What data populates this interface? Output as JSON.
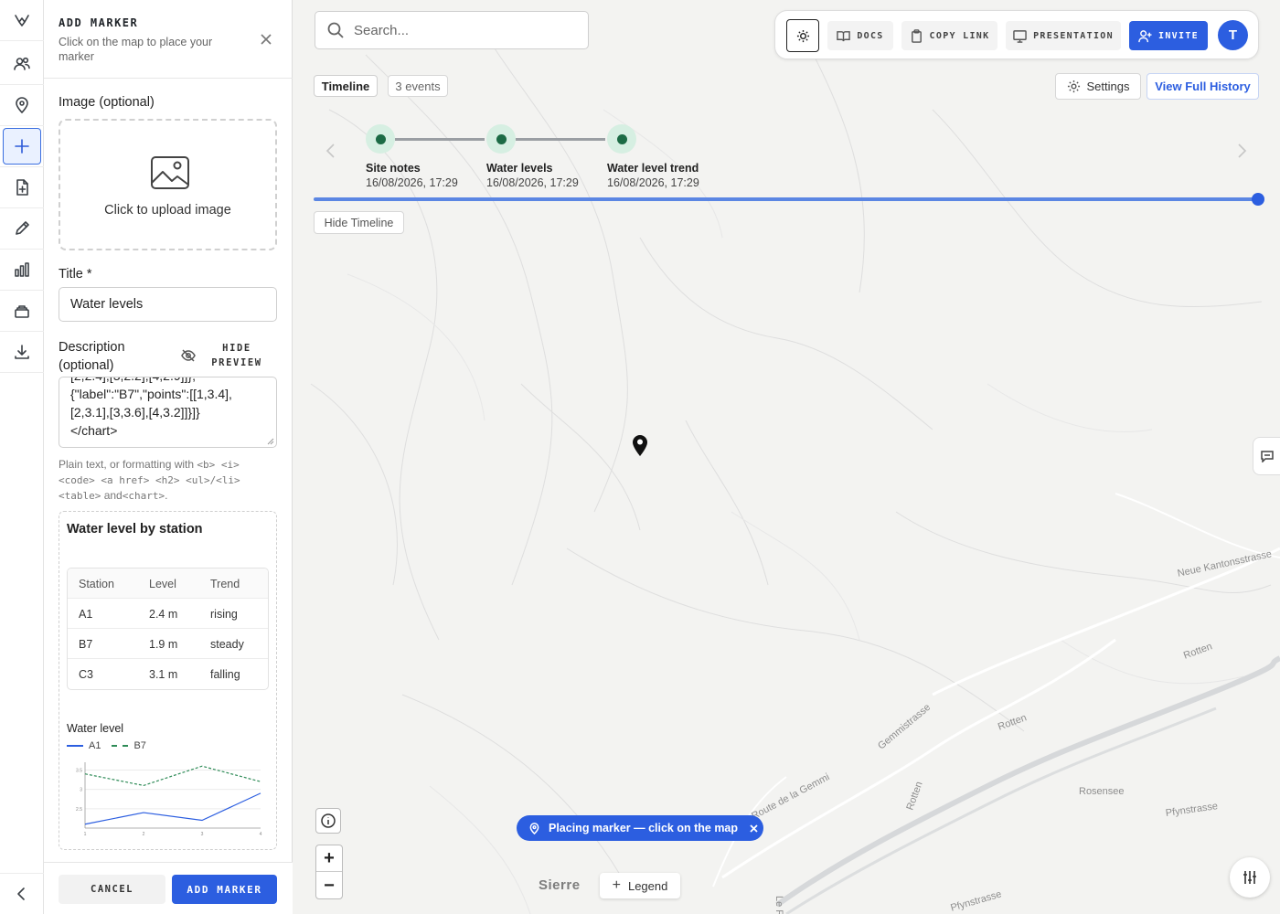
{
  "rail": {
    "items": [
      {
        "name": "logo-icon",
        "active": false
      },
      {
        "name": "users-icon",
        "active": false
      },
      {
        "name": "location-pin-icon",
        "active": false
      },
      {
        "name": "plus-icon",
        "active": true
      },
      {
        "name": "file-add-icon",
        "active": false
      },
      {
        "name": "pencil-icon",
        "active": false
      },
      {
        "name": "bar-chart-icon",
        "active": false
      },
      {
        "name": "layers-icon",
        "active": false
      },
      {
        "name": "download-icon",
        "active": false
      }
    ],
    "collapse_icon": "chevron-left-icon"
  },
  "panel": {
    "title": "ADD MARKER",
    "subtitle": "Click on the map to place your marker",
    "image_label": "Image (optional)",
    "upload_text": "Click to upload image",
    "title_label": "Title *",
    "title_value": "Water levels",
    "description_label": "Description (optional)",
    "hide_preview": "HIDE PREVIEW",
    "description_value": "[2,2.4],[3,2.2],[4,2.9]]},\n{\"label\":\"B7\",\"points\":[[1,3.4],\n[2,3.1],[3,3.6],[4,3.2]]}]}\n</chart>",
    "help": {
      "prefix": "Plain text, or formatting with",
      "tags1": "<b> <i> <code> <a href> <h2> <ul>/<li>",
      "tags2": "<table>",
      "and": "and",
      "tags3": "<chart>",
      "suffix": "."
    },
    "cancel": "CANCEL",
    "add": "ADD MARKER"
  },
  "preview": {
    "title": "Water level by station",
    "table": {
      "headers": [
        "Station",
        "Level",
        "Trend"
      ],
      "rows": [
        [
          "A1",
          "2.4 m",
          "rising"
        ],
        [
          "B7",
          "1.9 m",
          "steady"
        ],
        [
          "C3",
          "3.1 m",
          "falling"
        ]
      ]
    }
  },
  "chart_data": {
    "type": "line",
    "title": "Water level",
    "xlabel": "",
    "ylabel": "",
    "x": [
      1,
      2,
      3,
      4
    ],
    "series": [
      {
        "name": "A1",
        "values": [
          2.1,
          2.4,
          2.2,
          2.9
        ],
        "color": "#2c5ee0",
        "dash": "solid"
      },
      {
        "name": "B7",
        "values": [
          3.4,
          3.1,
          3.6,
          3.2
        ],
        "color": "#2e8b57",
        "dash": "dashed"
      }
    ],
    "ylim": [
      2.0,
      3.7
    ],
    "grid": true,
    "legend": "top-left"
  },
  "map": {
    "search_placeholder": "Search...",
    "toolbar": {
      "theme_icon": "sun-icon",
      "docs": "DOCS",
      "copy_link": "COPY LINK",
      "presentation": "PRESENTATION",
      "invite": "INVITE",
      "avatar_initial": "T"
    },
    "timeline_label": "Timeline",
    "events_count": "3 events",
    "settings": "Settings",
    "view_history": "View Full History",
    "hide_timeline": "Hide Timeline",
    "events": [
      {
        "name": "Site notes",
        "date": "16/08/2026, 17:29"
      },
      {
        "name": "Water levels",
        "date": "16/08/2026, 17:29"
      },
      {
        "name": "Water level trend",
        "date": "16/08/2026, 17:29"
      }
    ],
    "placing_banner": "Placing marker — click on the map",
    "legend": "Legend",
    "zoom_in": "+",
    "zoom_out": "−",
    "labels": {
      "city": "Sierre",
      "kantonsstrasse": "Neue Kantonsstrasse",
      "rotten1": "Rotten",
      "rotten2": "Rotten",
      "rotten3": "Rotten",
      "gemmistrasse": "Gemmistrasse",
      "route_gemmi": "Route de la Gemmi",
      "rosensee": "Rosensee",
      "pfynstrasse1": "Pfynstrasse",
      "pfynstrasse2": "Pfynstrasse",
      "rhone": "Le Rhône"
    },
    "colors": {
      "accent": "#2c5ee0",
      "event_dot": "#1c6b45",
      "river": "#c9ccd0"
    }
  }
}
